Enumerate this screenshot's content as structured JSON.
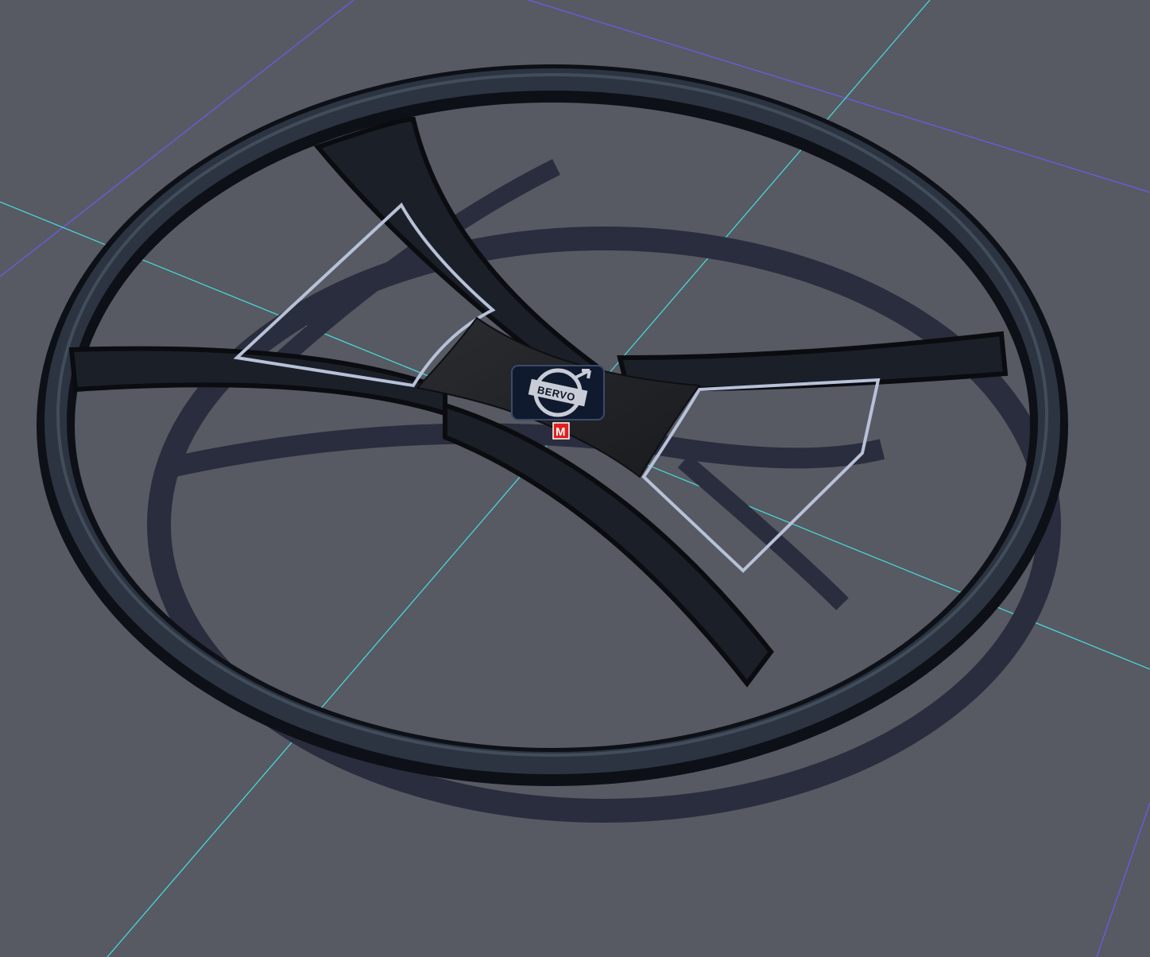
{
  "scene": {
    "background_color": "#575a63",
    "grid_colors": {
      "major_axis": "#46e0e0",
      "minor_axis": "#6a5cf0"
    },
    "model": "steering-wheel",
    "logo_text": "BERVO",
    "marker_label": "M",
    "marker_color": "#e0201e"
  }
}
